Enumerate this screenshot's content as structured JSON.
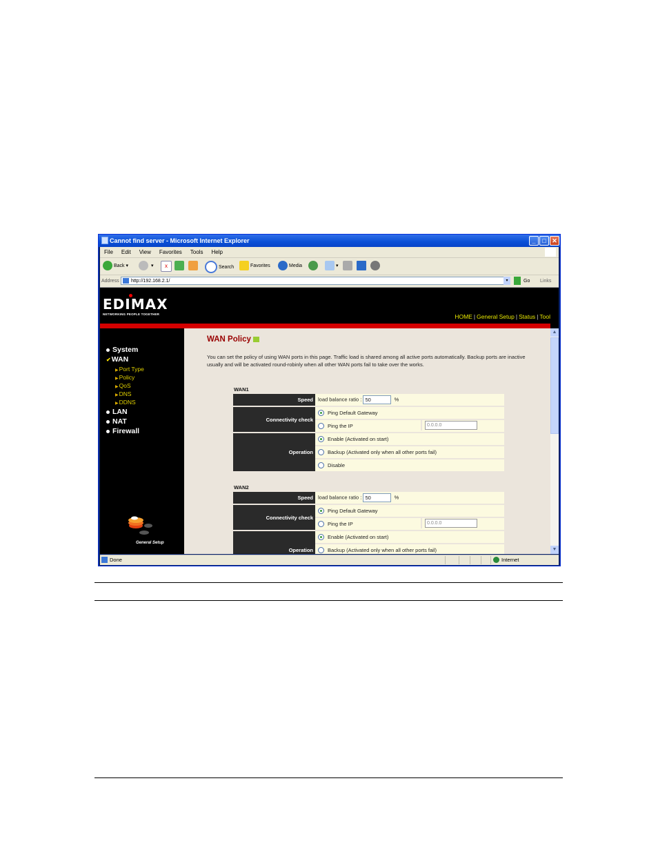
{
  "browser": {
    "title": "Cannot find server - Microsoft Internet Explorer",
    "menu": [
      "File",
      "Edit",
      "View",
      "Favorites",
      "Tools",
      "Help"
    ],
    "toolbar": {
      "back": "Back",
      "search": "Search",
      "favorites": "Favorites",
      "media": "Media"
    },
    "address_label": "Address",
    "url": "http://192.168.2.1/",
    "go_label": "Go",
    "links_label": "Links",
    "status_text": "Done",
    "zone": "Internet"
  },
  "header": {
    "logo": "EDIMAX",
    "tagline": "NETWORKING PEOPLE TOGETHER",
    "nav": [
      "HOME",
      "General Setup",
      "Status",
      "Tool"
    ],
    "colors": {
      "accent_red": "#d40000",
      "nav_yellow": "#e8e800"
    }
  },
  "sidebar": {
    "items": [
      {
        "label": "System"
      },
      {
        "label": "WAN",
        "checked": true
      },
      {
        "label": "LAN"
      },
      {
        "label": "NAT"
      },
      {
        "label": "Firewall"
      }
    ],
    "wan_sub": [
      "Port Type",
      "Policy",
      "QoS",
      "DNS",
      "DDNS"
    ],
    "footer_label": "General Setup"
  },
  "page": {
    "title": "WAN Policy",
    "description": "You can set the policy of using WAN ports in this page. Traffic load is shared among all active ports automatically. Backup ports are inactive usually and will be activated round-robinly when all other WAN ports fail to take over the works.",
    "labels": {
      "speed": "Speed",
      "connectivity": "Connectivity check",
      "operation": "Operation",
      "ratio_label": "load balance ratio :",
      "percent": "%",
      "ping_gw": "Ping Default Gateway",
      "ping_ip": "Ping the IP",
      "enable": "Enable (Activated on start)",
      "backup": "Backup (Activated only when all other ports fail)",
      "disable": "Disable"
    },
    "wans": [
      {
        "name": "WAN1",
        "ratio": "50",
        "ip": "0.0.0.0",
        "connectivity": "ping_gw",
        "operation": "enable"
      },
      {
        "name": "WAN2",
        "ratio": "50",
        "ip": "0.0.0.0",
        "connectivity": "ping_gw",
        "operation": "enable"
      }
    ]
  }
}
